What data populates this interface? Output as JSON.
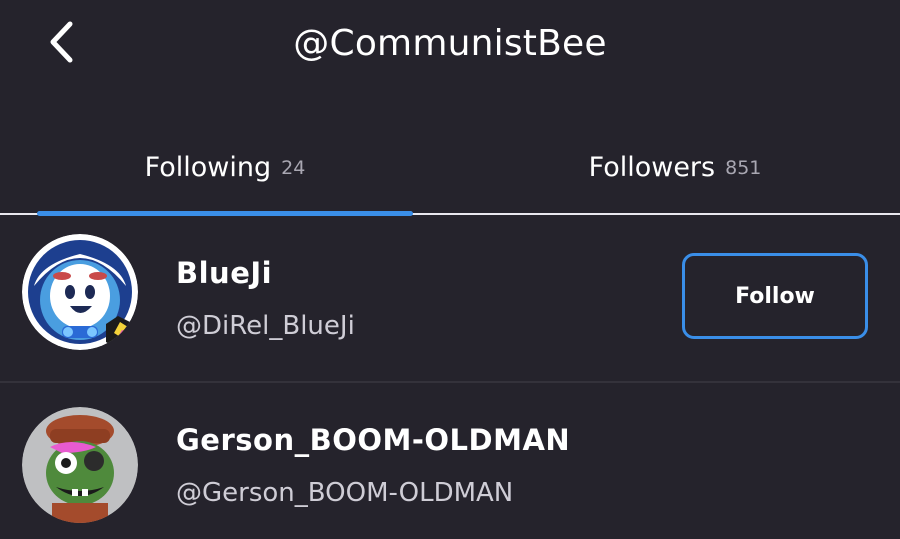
{
  "header": {
    "title": "@CommunistBee",
    "back_icon": "chevron-left-icon"
  },
  "tabs": [
    {
      "label": "Following",
      "count": "24",
      "active": true
    },
    {
      "label": "Followers",
      "count": "851",
      "active": false
    }
  ],
  "users": [
    {
      "display_name": "BlueJi",
      "handle": "@DiRel_BlueJi",
      "follow_label": "Follow"
    },
    {
      "display_name": "Gerson_BOOM-OLDMAN",
      "handle": "@Gerson_BOOM-OLDMAN"
    }
  ],
  "colors": {
    "background": "#25232c",
    "accent": "#3a8ee8",
    "muted_text": "#a9a7b2"
  }
}
